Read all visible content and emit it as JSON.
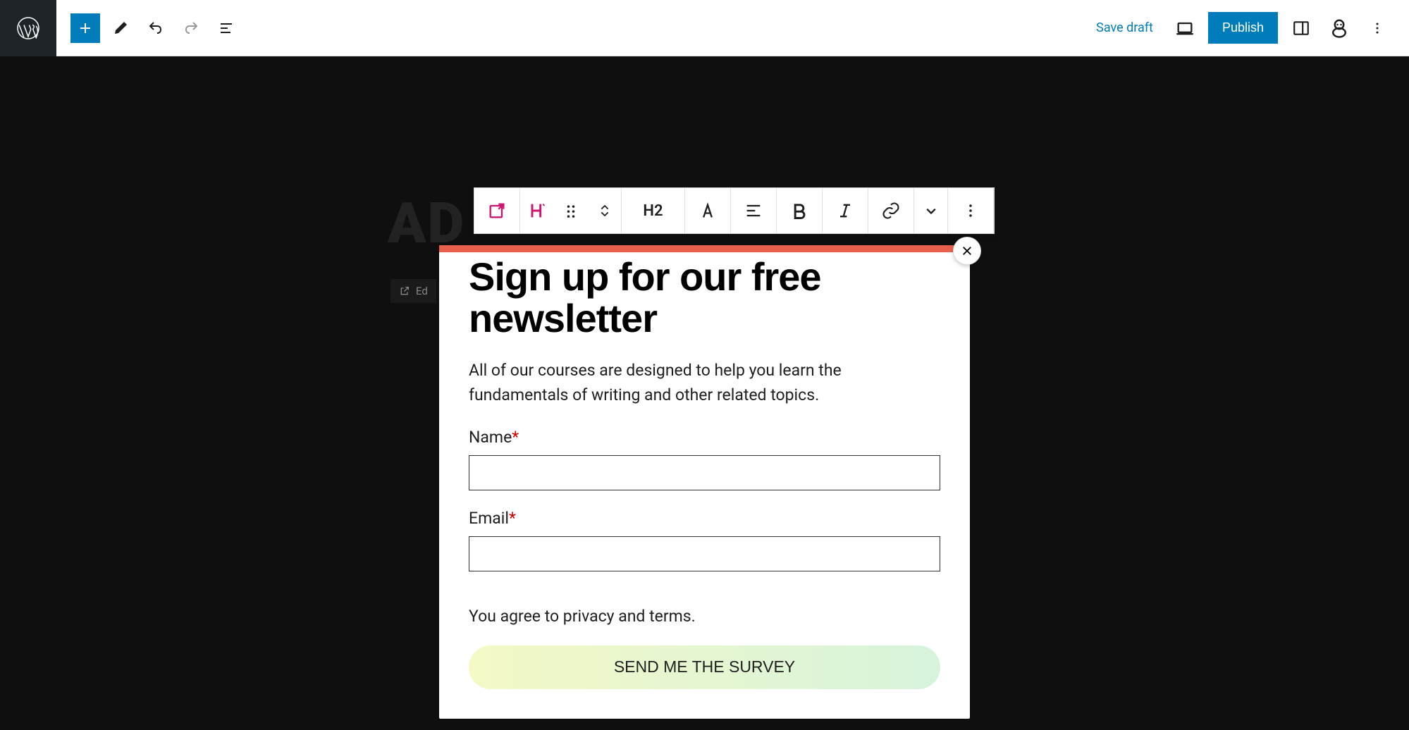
{
  "topbar": {
    "save_draft": "Save draft",
    "publish": "Publish"
  },
  "block_toolbar": {
    "heading_level": "H2"
  },
  "background": {
    "title_fragment": "AD",
    "edit_label": "Ed"
  },
  "modal": {
    "title": "Sign up for our free newsletter",
    "description": "All of our courses are designed to help you learn the fundamentals of writing and other related topics.",
    "fields": {
      "name": {
        "label": "Name",
        "required": "*"
      },
      "email": {
        "label": "Email",
        "required": "*"
      }
    },
    "terms": "You agree to privacy and terms.",
    "submit": "SEND ME THE SURVEY"
  }
}
